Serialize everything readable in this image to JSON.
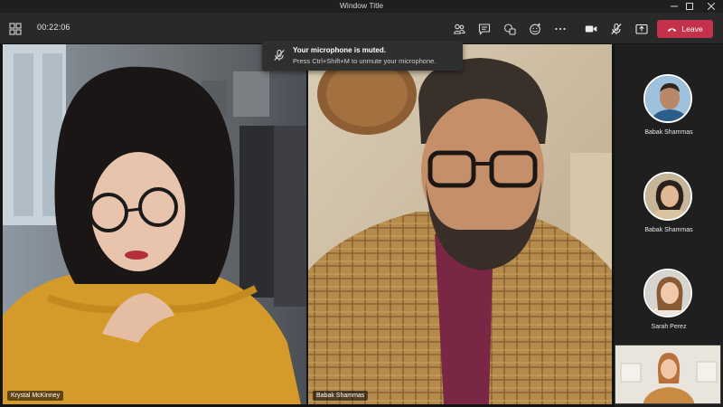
{
  "window": {
    "title": "Window Title"
  },
  "toolbar": {
    "timer": "00:22:06",
    "leave_label": "Leave",
    "icons": [
      "grid-view-icon",
      "people-icon",
      "chat-icon",
      "share-tray-icon",
      "reactions-icon",
      "more-icon",
      "camera-icon",
      "mic-muted-icon",
      "share-icon"
    ]
  },
  "toast": {
    "title": "Your microphone is muted.",
    "message": "Press Ctrl+Shift+M to unmute your microphone."
  },
  "tiles": [
    {
      "name": "Krystal McKinney"
    },
    {
      "name": "Babak Shammas"
    }
  ],
  "panel": {
    "participants": [
      {
        "name": "Babak Shammas"
      },
      {
        "name": "Babak Shammas"
      },
      {
        "name": "Sarah Perez"
      }
    ]
  },
  "colors": {
    "leave": "#c4314b",
    "toolbar": "#292929",
    "background": "#1f1f1f"
  }
}
